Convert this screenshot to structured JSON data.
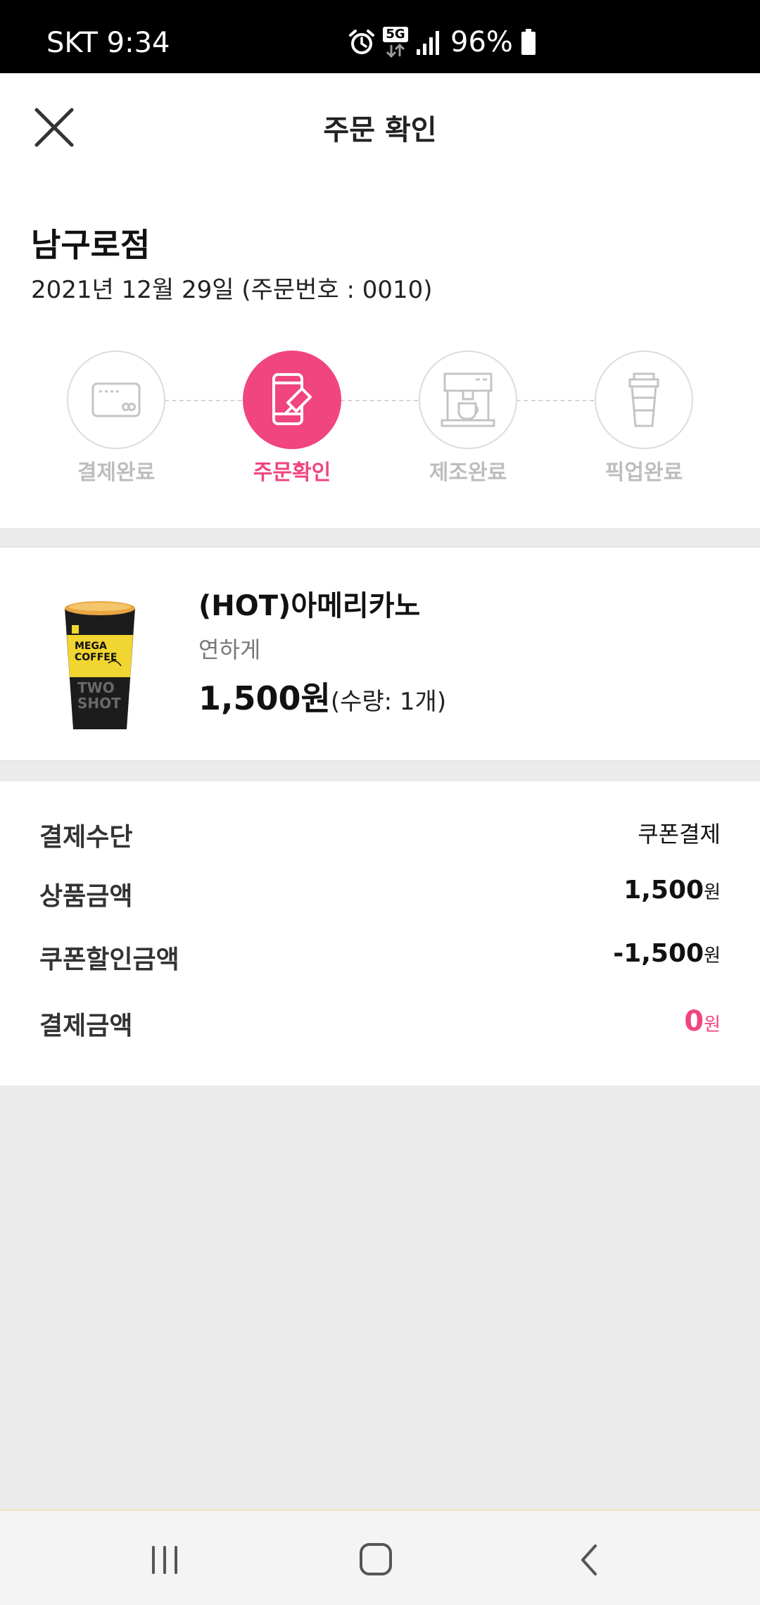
{
  "status_bar": {
    "carrier_time": "SKT 9:34",
    "network": "5G",
    "battery_percent": "96%",
    "icons": [
      "alarm-icon",
      "5g-icon",
      "signal-icon",
      "battery-icon"
    ]
  },
  "header": {
    "title": "주문 확인",
    "close_icon": "close-icon"
  },
  "store": {
    "name": "남구로점",
    "date_order": "2021년 12월 29일 (주문번호 : 0010)"
  },
  "steps": [
    {
      "label": "결제완료",
      "icon": "card-icon",
      "active": false
    },
    {
      "label": "주문확인",
      "icon": "phone-order-icon",
      "active": true
    },
    {
      "label": "제조완료",
      "icon": "coffee-machine-icon",
      "active": false
    },
    {
      "label": "픽업완료",
      "icon": "takeout-cup-icon",
      "active": false
    }
  ],
  "product": {
    "name": "(HOT)아메리카노",
    "option": "연하게",
    "price": "1,500원",
    "quantity": "(수량: 1개)",
    "image_text": [
      "MEGA",
      "COFFEE",
      "TWO",
      "SHOT"
    ]
  },
  "summary": {
    "payment_method_label": "결제수단",
    "payment_method_value": "쿠폰결제",
    "product_amount_label": "상품금액",
    "product_amount_value": "1,500",
    "coupon_discount_label": "쿠폰할인금액",
    "coupon_discount_value": "-1,500",
    "payment_amount_label": "결제금액",
    "payment_amount_value": "0",
    "currency": "원"
  },
  "colors": {
    "accent": "#f0457f",
    "inactive": "#bdbdbd",
    "background": "#ebebeb"
  },
  "nav": {
    "icons": [
      "recent-apps-icon",
      "home-icon",
      "back-icon"
    ]
  }
}
